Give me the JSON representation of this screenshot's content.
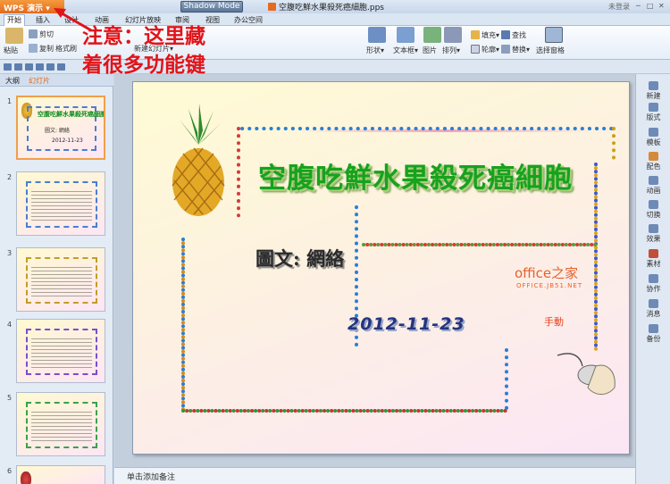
{
  "titlebar": {
    "wps_label": "WPS 演示",
    "shadow_mode": "Shadow Mode",
    "doc_title": "空腹吃鮮水果殺死癌細胞.pps",
    "login": "未登录"
  },
  "menu_tabs": [
    "开始",
    "插入",
    "设计",
    "动画",
    "幻灯片放映",
    "审阅",
    "视图",
    "办公空间"
  ],
  "ribbon": {
    "paste": "粘贴",
    "cut": "剪切",
    "copy": "复制",
    "format_painter": "格式刷",
    "new_slide": "新建幻灯片",
    "shape": "形状",
    "textbox": "文本框",
    "picture": "图片",
    "arrange": "排列",
    "fill": "填充",
    "outline": "轮廓",
    "find": "查找",
    "replace": "替换",
    "selection_pane": "选择窗格"
  },
  "left_panel": {
    "tab_outline": "大纲",
    "tab_slides": "幻灯片",
    "slide_numbers": [
      "1",
      "2",
      "3",
      "4",
      "5",
      "6"
    ],
    "thumb1_title": "空腹吃鮮水果殺死癌細胞",
    "thumb1_sub": "圖文: 網絡",
    "thumb1_date": "2012-11-23"
  },
  "slide": {
    "title": "空腹吃鮮水果殺死癌細胞",
    "subtitle": "圖文: 網絡",
    "date": "2012-11-23",
    "advance": "手動"
  },
  "right_sidebar": [
    "新建",
    "版式",
    "模板",
    "配色",
    "动画",
    "切换",
    "效果",
    "素材",
    "协作",
    "消息",
    "备份"
  ],
  "notes_placeholder": "单击添加备注",
  "annotation": {
    "line1": "注意：这里藏",
    "line2": "着很多功能键"
  },
  "watermark": {
    "brand": "office之家",
    "url": "OFFICE.JB51.NET"
  },
  "colors": {
    "title_green": "#17a21e",
    "annotation_red": "#e0141a",
    "wps_orange": "#e2691b"
  }
}
